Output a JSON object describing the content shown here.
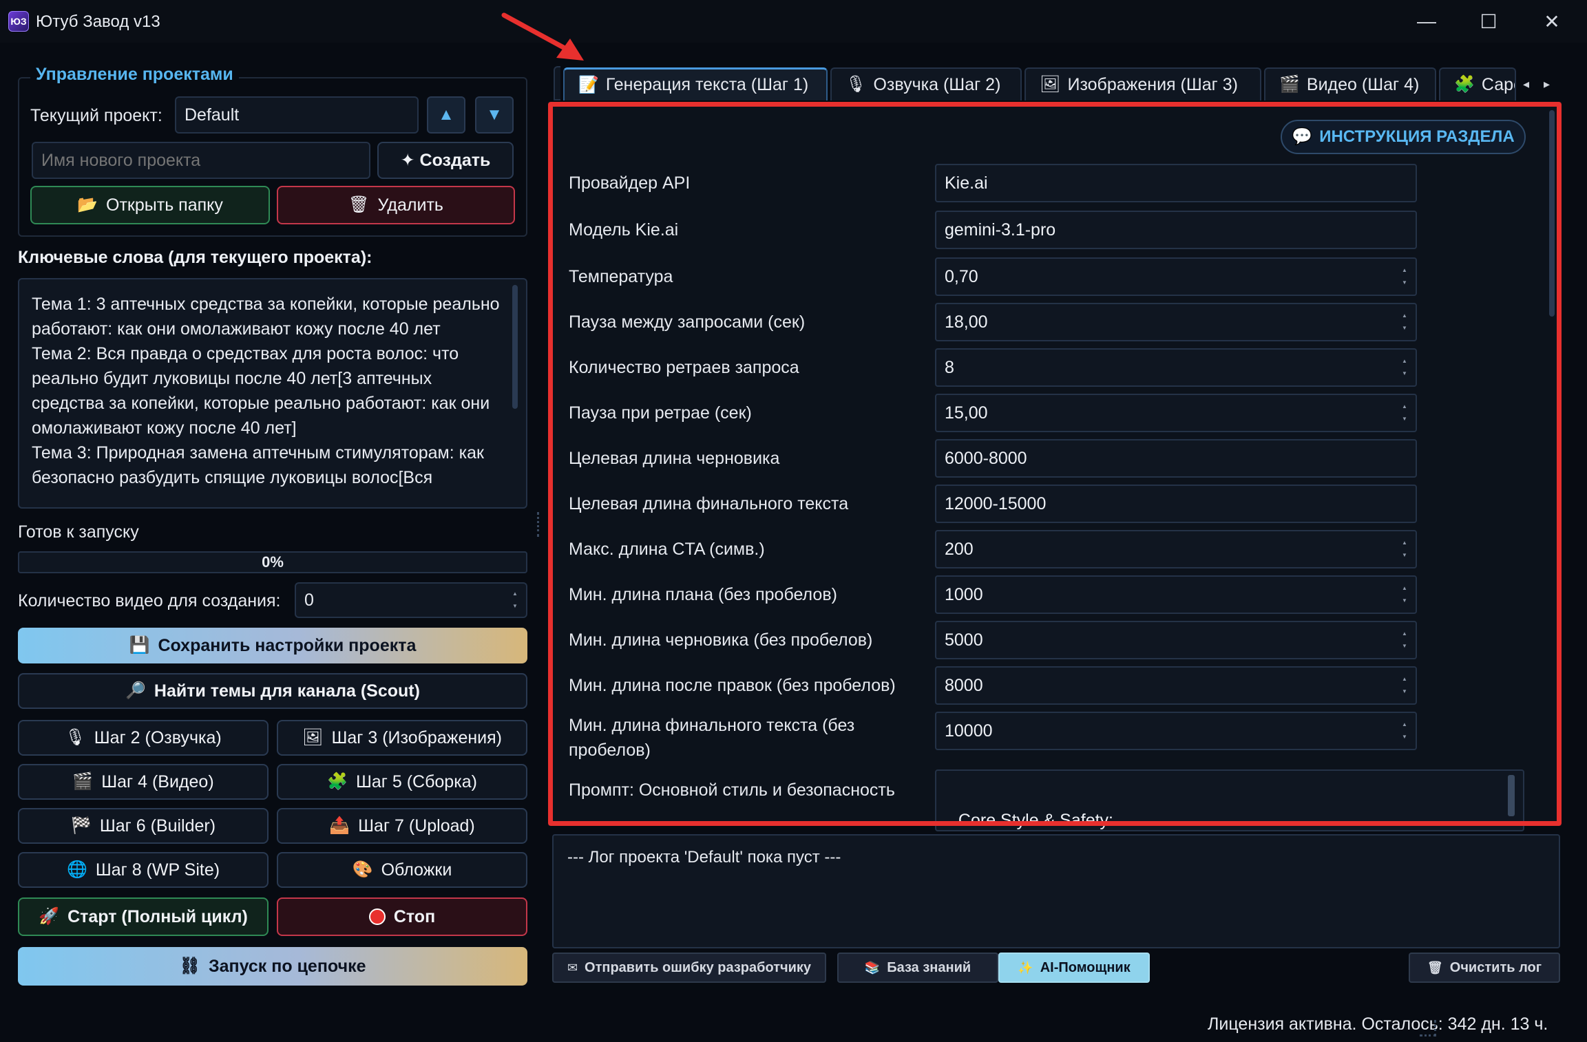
{
  "window": {
    "title": "Ютуб Завод v13",
    "app_icon_label": "ЮЗ",
    "minimize_glyph": "—",
    "maximize_glyph": "☐",
    "close_glyph": "✕"
  },
  "projects": {
    "group_title": "Управление проектами",
    "current_label": "Текущий проект:",
    "current_value": "Default",
    "up_glyph": "▲",
    "down_glyph": "▼",
    "new_name_placeholder": "Имя нового проекта",
    "create_label": "✦ Создать",
    "open_folder_label": "Открыть папку",
    "delete_label": "Удалить"
  },
  "keywords": {
    "title": "Ключевые слова (для текущего проекта):",
    "text": "Тема 1: 3 аптечных средства за копейки, которые реально работают: как они омолаживают кожу после 40 лет\nТема 2: Вся правда о средствах для роста волос: что реально будит луковицы после 40 лет[3 аптечных средства за копейки, которые реально работают: как они омолаживают кожу после 40 лет]\nТема 3: Природная замена аптечным стимуляторам: как безопасно разбудить спящие луковицы волос[Вся"
  },
  "status": {
    "ready_text": "Готов к запуску",
    "progress_text": "0%",
    "progress_fraction": 0,
    "video_count_label": "Количество видео для создания:",
    "video_count_value": "0"
  },
  "actions": {
    "save_settings": "Сохранить настройки проекта",
    "find_topics": "Найти темы для канала (Scout)",
    "step2": "Шаг 2 (Озвучка)",
    "step3": "Шаг 3 (Изображения)",
    "step4": "Шаг 4 (Видео)",
    "step5": "Шаг 5 (Сборка)",
    "step6": "Шаг 6 (Builder)",
    "step7": "Шаг 7 (Upload)",
    "step8": "Шаг 8 (WP Site)",
    "covers": "Обложки",
    "start": "Старт (Полный цикл)",
    "stop": "Стоп",
    "chain": "Запуск по цепочке"
  },
  "tabs": [
    {
      "label": "Генерация текста (Шаг 1)",
      "icon": "📝"
    },
    {
      "label": "Озвучка (Шаг 2)",
      "icon": "🎙"
    },
    {
      "label": "Изображения (Шаг 3)",
      "icon": "🖼"
    },
    {
      "label": "Видео (Шаг 4)",
      "icon": "🎬"
    },
    {
      "label": "Сарс",
      "icon": "🧩"
    }
  ],
  "tab_nav": {
    "left": "◂",
    "right": "▸"
  },
  "section": {
    "instruction_button": "ИНСТРУКЦИЯ РАЗДЕЛА",
    "fields": [
      {
        "label": "Провайдер API",
        "value": "Kie.ai"
      },
      {
        "label": "Модель Kie.ai",
        "value": "gemini-3.1-pro"
      },
      {
        "label": "Температура",
        "value": "0,70"
      },
      {
        "label": "Пауза между запросами (сек)",
        "value": "18,00"
      },
      {
        "label": "Количество ретраев запроса",
        "value": "8"
      },
      {
        "label": "Пауза при ретрае (сек)",
        "value": "15,00"
      },
      {
        "label": "Целевая длина черновика",
        "value": "6000-8000"
      },
      {
        "label": "Целевая длина финального текста",
        "value": "12000-15000"
      },
      {
        "label": "Макс. длина CTA (симв.)",
        "value": "200"
      },
      {
        "label": "Мин. длина плана (без пробелов)",
        "value": "1000"
      },
      {
        "label": "Мин. длина черновика (без пробелов)",
        "value": "5000"
      },
      {
        "label": "Мин. длина после правок (без пробелов)",
        "value": "8000"
      },
      {
        "label": "Мин. длина финального текста (без\nпробелов)",
        "value": "10000"
      }
    ],
    "prompt_label": "Промпт: Основной стиль и безопасность",
    "prompt_text": "Core Style & Safety:\nТы — опытный, глубоко уважаемый эксперт в области"
  },
  "log": {
    "text": "--- Лог проекта 'Default' пока пуст ---",
    "send_error": "Отправить ошибку разработчику",
    "knowledge_base": "База знаний",
    "ai_helper": "AI-Помощник",
    "clear_log": "Очистить лог"
  },
  "license": "Лицензия активна. Осталось: 342 дн. 13 ч.",
  "colors": {
    "accent": "#57b6f0",
    "annotation_red": "#e8302e",
    "background": "#070b12"
  }
}
